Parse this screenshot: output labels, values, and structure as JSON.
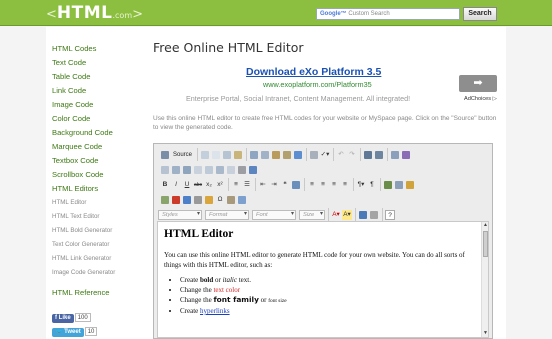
{
  "header": {
    "logo": {
      "left": "<",
      "main": "HTML",
      "domain": ".com",
      "right": ">"
    },
    "search_placeholder": "Custom Search",
    "search_brand": "Google™",
    "search_button": "Search"
  },
  "sidebar": {
    "links": [
      "HTML Codes",
      "Text Code",
      "Table Code",
      "Link Code",
      "Image Code",
      "Color Code",
      "Background Code",
      "Marquee Code",
      "Textbox Code",
      "Scrollbox Code",
      "HTML Editors"
    ],
    "tools": [
      "HTML Editor",
      "HTML Text Editor",
      "HTML Bold Generator",
      "Text Color Generator",
      "HTML Link Generator",
      "Image Code Generator"
    ],
    "reference": "HTML Reference",
    "social": {
      "like_label": "Like",
      "like_count": "100",
      "tweet_label": "Tweet",
      "tweet_count": "10"
    }
  },
  "main": {
    "title": "Free Online HTML Editor",
    "ad": {
      "headline": "Download eXo Platform 3.5",
      "url": "www.exoplatform.com/Platform35",
      "description": "Enterprise Portal, Social Intranet, Content Management. All integrated!",
      "choices": "AdChoices ▷"
    },
    "intro": "Use this online HTML editor to create free HTML codes for your website or MySpace page. Click on the \"Source\" button to view the generated code."
  },
  "editor": {
    "source_label": "Source",
    "styles": "Styles",
    "format": "Format",
    "font": "Font",
    "size": "Size",
    "content": {
      "heading": "HTML Editor",
      "paragraph": "You can use this online HTML editor to generate HTML code for your own website. You can do all sorts of things with this HTML editor, such as:",
      "items": [
        {
          "prefix": "Create ",
          "bold": "bold",
          "mid": " or ",
          "italic": "italic",
          "suffix": " text."
        },
        {
          "prefix": "Change the ",
          "colored": "text color"
        },
        {
          "prefix": "Change the ",
          "font": "font family",
          "mid": " or ",
          "size": "font size"
        },
        {
          "prefix": "Create ",
          "link": "hyperlinks"
        }
      ]
    }
  },
  "colors": {
    "header": "#8cbf3f",
    "nav": "#3e7a14",
    "ad_link": "#1a52b3"
  }
}
